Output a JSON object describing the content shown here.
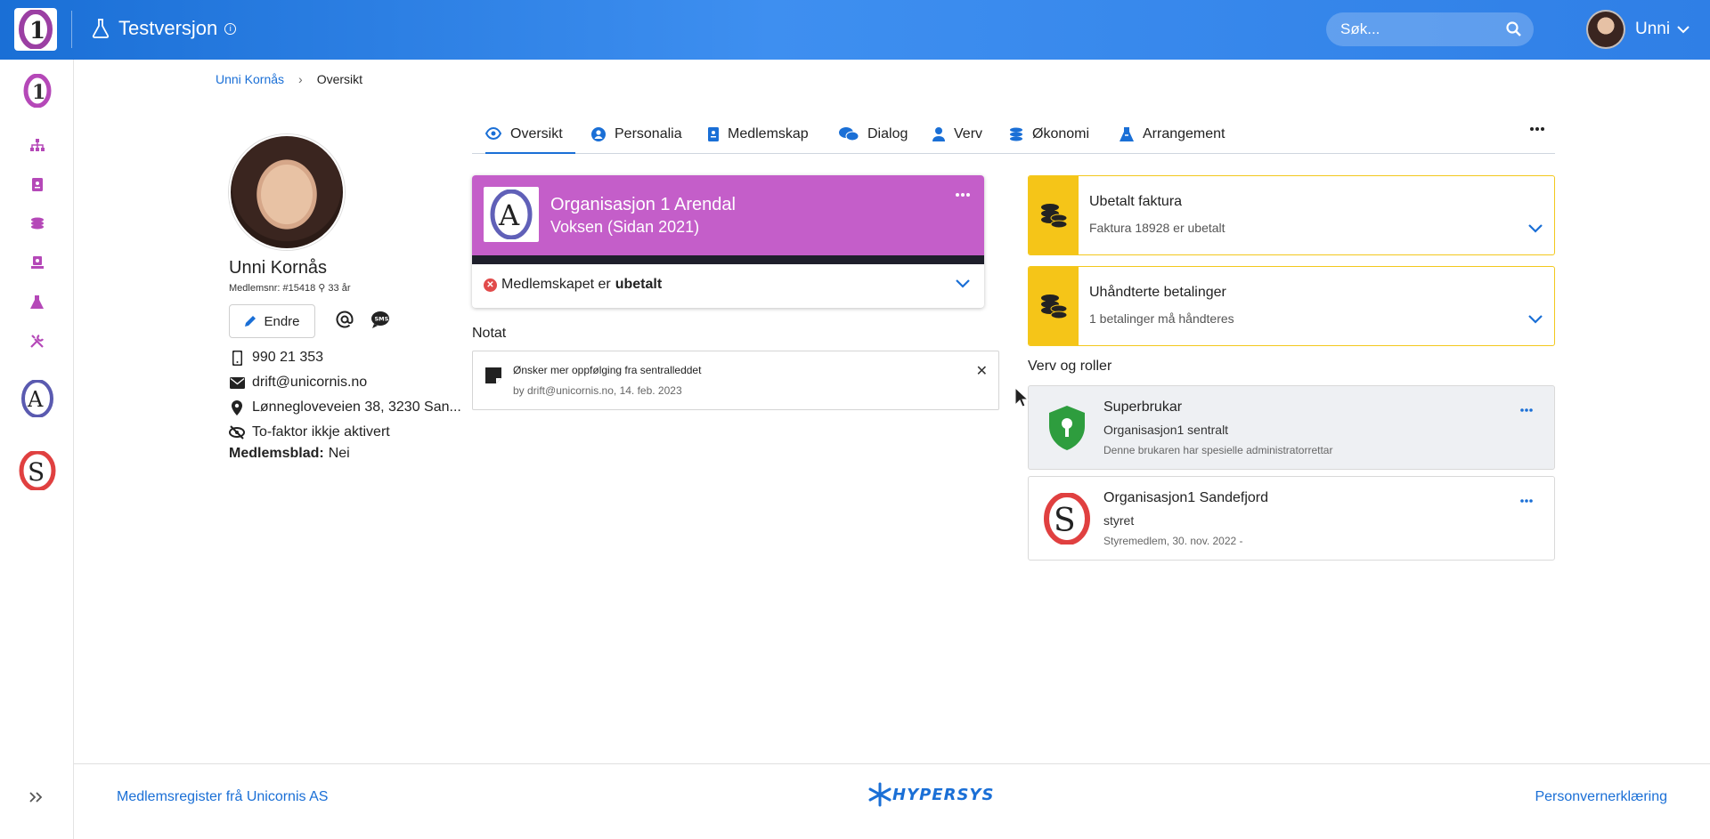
{
  "topbar": {
    "env_label": "Testversjon",
    "search_placeholder": "Søk...",
    "user_name": "Unni"
  },
  "rail": {
    "items": [
      "home-logo",
      "org-tree-icon",
      "member-card-icon",
      "coins-icon",
      "badge-icon",
      "flask-icon",
      "tools-icon",
      "org-a-logo",
      "org-s-logo"
    ]
  },
  "breadcrumb": {
    "parent": "Unni Kornås",
    "current": "Oversikt"
  },
  "profile": {
    "name": "Unni Kornås",
    "member_no": "Medlemsnr: #15418",
    "age": "33 år",
    "edit_label": "Endre",
    "phone": "990 21 353",
    "email": "drift@unicornis.no",
    "address": "Lønnegloveveien 38, 3230 San...",
    "twofactor": "To-faktor ikkje aktivert",
    "magazine_label": "Medlemsblad:",
    "magazine_value": "Nei"
  },
  "tabs": [
    {
      "label": "Oversikt",
      "icon": "eye-icon",
      "active": true
    },
    {
      "label": "Personalia",
      "icon": "user-circle-icon"
    },
    {
      "label": "Medlemskap",
      "icon": "id-badge-icon"
    },
    {
      "label": "Dialog",
      "icon": "comments-icon"
    },
    {
      "label": "Verv",
      "icon": "person-icon"
    },
    {
      "label": "Økonomi",
      "icon": "coins-icon"
    },
    {
      "label": "Arrangement",
      "icon": "campfire-icon"
    }
  ],
  "membership": {
    "org": "Organisasjon 1 Arendal",
    "category": "Voksen (Sidan 2021)",
    "status_prefix": "Medlemskapet er",
    "status_value": "ubetalt",
    "accent": "#c45ec9"
  },
  "notes": {
    "heading": "Notat",
    "text": "Ønsker mer oppfølging fra sentralleddet",
    "by": "by drift@unicornis.no, 14. feb. 2023"
  },
  "alerts": [
    {
      "title": "Ubetalt faktura",
      "sub": "Faktura 18928 er ubetalt"
    },
    {
      "title": "Uhåndterte betalinger",
      "sub": "1 betalinger må håndteres"
    }
  ],
  "roles": {
    "heading": "Verv og roller",
    "items": [
      {
        "title": "Superbrukar",
        "org": "Organisasjon1 sentralt",
        "desc": "Denne brukaren har spesielle administratorrettar"
      },
      {
        "title": "Organisasjon1 Sandefjord",
        "org": "styret",
        "desc": "Styremedlem, 30. nov. 2022 -"
      }
    ]
  },
  "footer": {
    "left": "Medlemsregister frå Unicornis AS",
    "logo_text": "HYPERSYS",
    "right": "Personvernerklæring"
  },
  "colors": {
    "primary": "#1a6fd6",
    "warning": "#f5c518",
    "danger": "#e14b4b",
    "rail_icon": "#b548b8"
  }
}
